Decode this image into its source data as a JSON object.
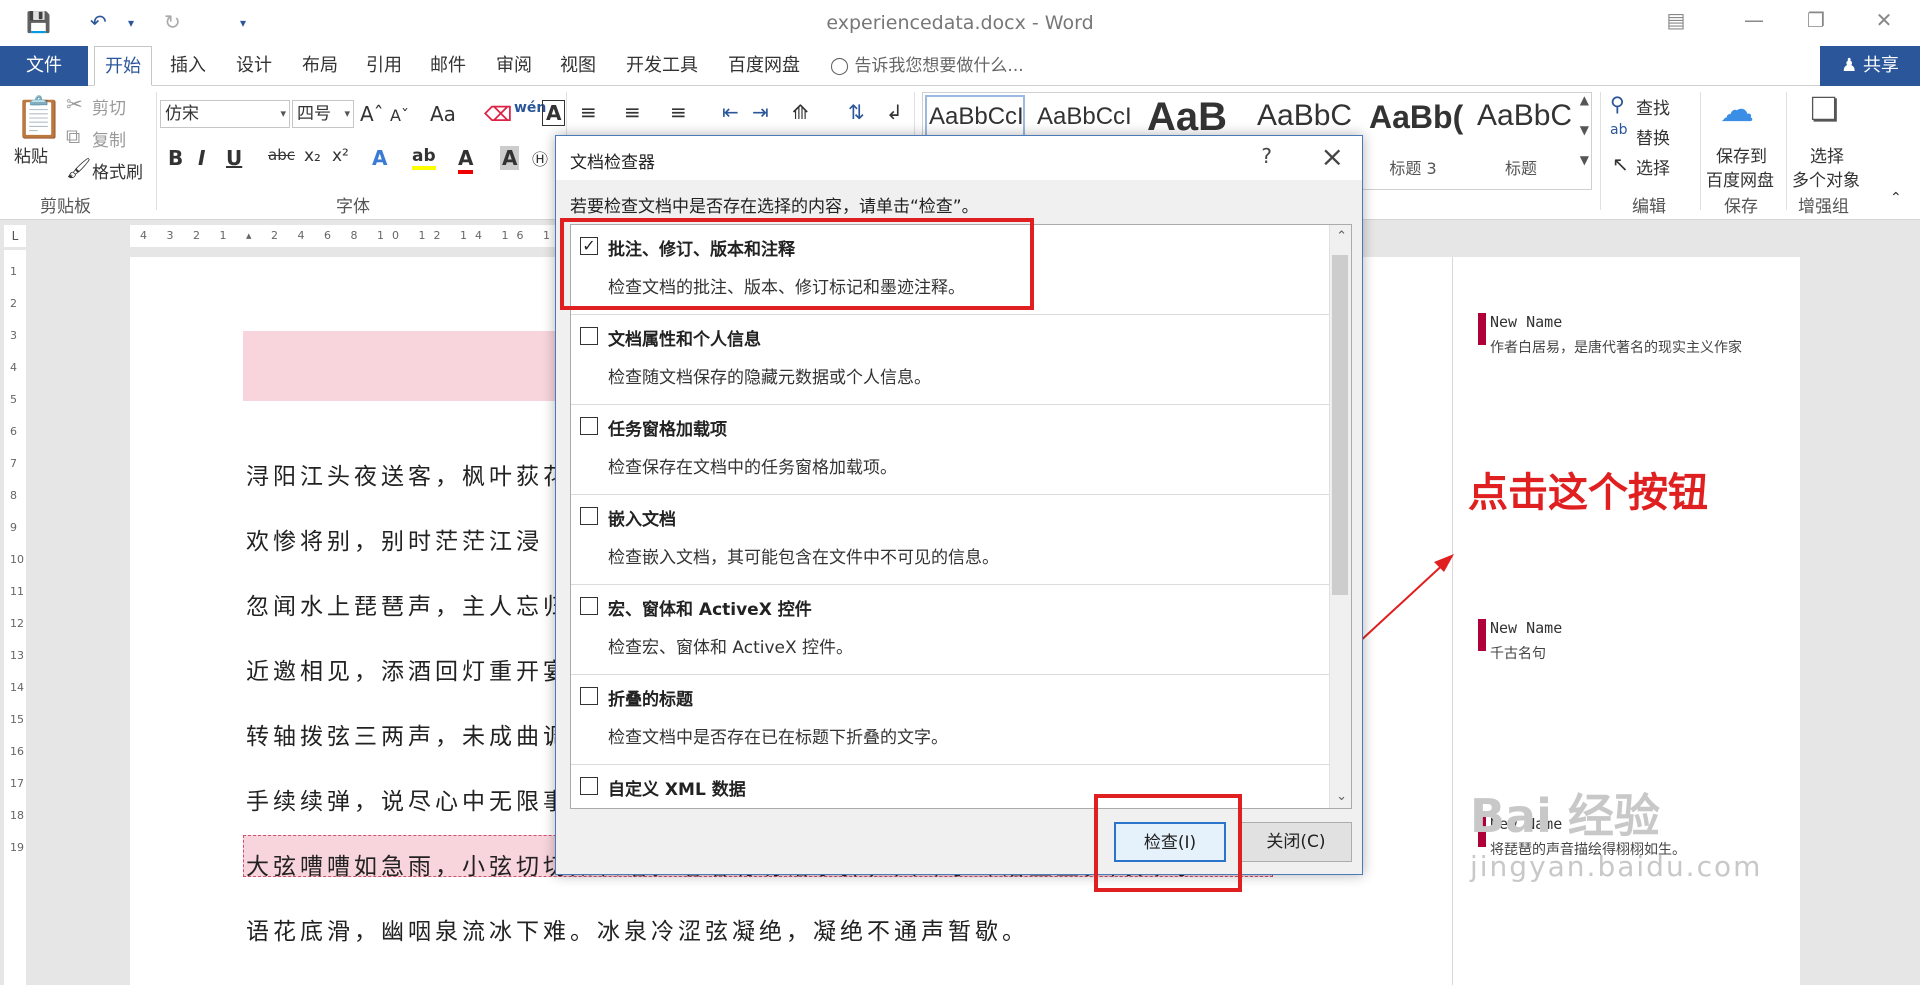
{
  "titlebar": {
    "title": "experiencedata.docx - Word",
    "save_icon": "save-icon",
    "undo_icon": "undo-icon",
    "redo_icon": "redo-icon"
  },
  "tabs": {
    "file": "文件",
    "items": [
      "开始",
      "插入",
      "设计",
      "布局",
      "引用",
      "邮件",
      "审阅",
      "视图",
      "开发工具",
      "百度网盘"
    ],
    "tellme": "告诉我您想要做什么...",
    "share": "共享"
  },
  "ribbon": {
    "clipboard": {
      "paste": "粘贴",
      "cut": "剪切",
      "copy": "复制",
      "format_painter": "格式刷",
      "label": "剪贴板"
    },
    "font": {
      "name": "仿宋",
      "size": "四号",
      "label": "字体",
      "case": "Aa"
    },
    "styles": [
      {
        "sample": "AaBbCcI",
        "name": ""
      },
      {
        "sample": "AaBbCcI",
        "name": ""
      },
      {
        "sample": "AaB",
        "name": ""
      },
      {
        "sample": "AaBbC",
        "name": ""
      },
      {
        "sample": "AaBb(",
        "name": "标题 3"
      },
      {
        "sample": "AaBbC",
        "name": "标题"
      }
    ],
    "editing": {
      "find": "查找",
      "replace": "替换",
      "select": "选择",
      "label": "编辑"
    },
    "save": {
      "line1": "保存到",
      "line2": "百度网盘",
      "label": "保存"
    },
    "enhance": {
      "line1": "选择",
      "line2": "多个对象",
      "label": "增强组"
    }
  },
  "document": {
    "lines": [
      "浔阳江头夜送客，枫叶荻花",
      "欢惨将别，别时茫茫江浸",
      "忽闻水上琵琶声，主人忘归",
      "近邀相见，添酒回灯重开宴",
      "转轴拨弦三两声，未成曲调",
      "手续续弹，说尽心中无限事",
      "大弦嘈嘈如急雨，小弦切切如私语。嘈嘈切切错杂弹，大珠小珠落玉盘。间关莺",
      "语花底滑，幽咽泉流冰下难。冰泉冷涩弦凝绝，凝绝不通声暂歇。"
    ]
  },
  "comments": [
    {
      "author": "New Name",
      "text": "作者白居易，是唐代著名的现实主义作家"
    },
    {
      "author": "New Name",
      "text": "千古名句"
    },
    {
      "author": "New Name",
      "text": "将琵琶的声音描绘得栩栩如生。"
    }
  ],
  "annotation": "点击这个按钮",
  "watermark": {
    "logo": "Bai 经验",
    "url": "jingyan.baidu.com"
  },
  "dialog": {
    "title": "文档检查器",
    "help": "?",
    "prompt": "若要检查文档中是否存在选择的内容，请单击“检查”。",
    "items": [
      {
        "title": "批注、修订、版本和注释",
        "desc": "检查文档的批注、版本、修订标记和墨迹注释。",
        "checked": "✓"
      },
      {
        "title": "文档属性和个人信息",
        "desc": "检查随文档保存的隐藏元数据或个人信息。",
        "checked": ""
      },
      {
        "title": "任务窗格加载项",
        "desc": "检查保存在文档中的任务窗格加载项。",
        "checked": ""
      },
      {
        "title": "嵌入文档",
        "desc": "检查嵌入文档，其可能包含在文件中不可见的信息。",
        "checked": ""
      },
      {
        "title": "宏、窗体和 ActiveX 控件",
        "desc": "检查宏、窗体和 ActiveX 控件。",
        "checked": ""
      },
      {
        "title": "折叠的标题",
        "desc": "检查文档中是否存在已在标题下折叠的文字。",
        "checked": ""
      },
      {
        "title": "自定义 XML 数据",
        "desc": "",
        "checked": ""
      }
    ],
    "inspect_btn": "检查(I)",
    "close_btn": "关闭(C)"
  },
  "colors": {
    "accent": "#2b579a",
    "highlight": "#e02020",
    "comment_bar": "#b0003a"
  }
}
